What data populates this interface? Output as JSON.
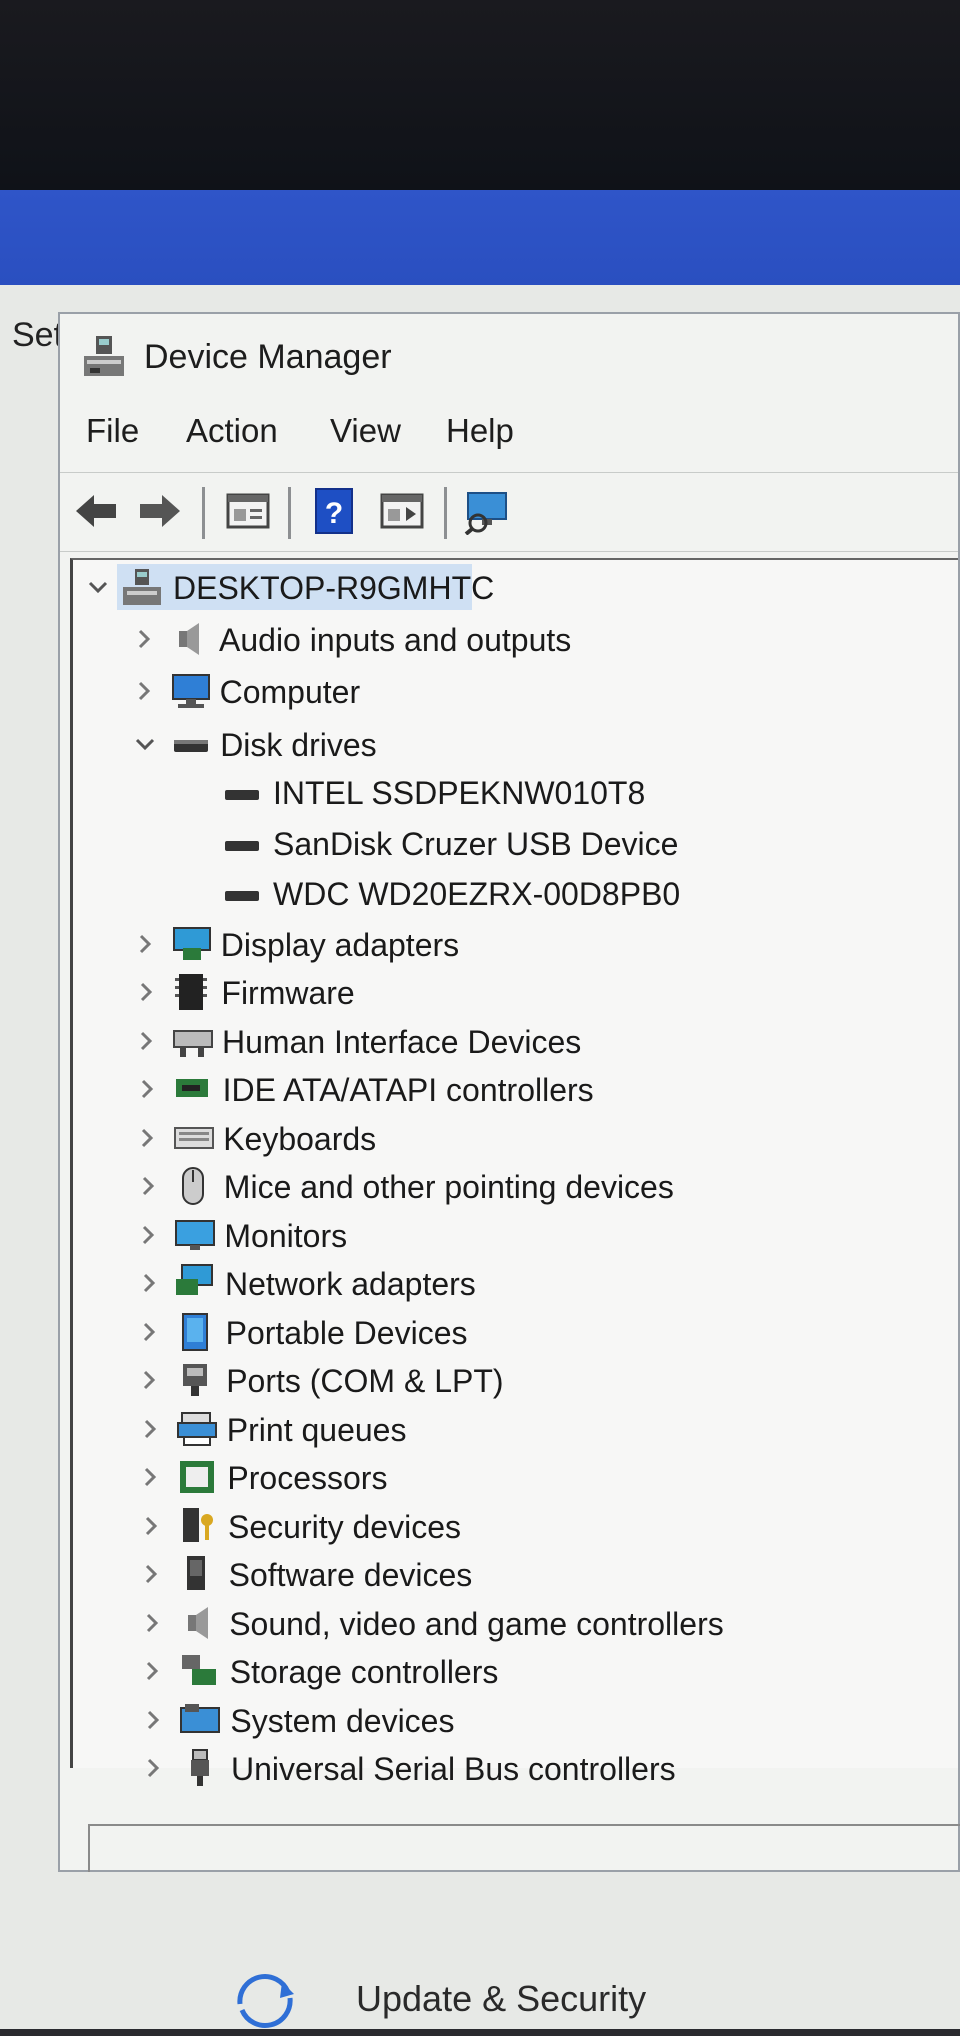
{
  "settings": {
    "partial_title": "Set",
    "bottom_item": "Update & Security"
  },
  "window": {
    "title": "Device Manager",
    "menu": [
      "File",
      "Action",
      "View",
      "Help"
    ]
  },
  "toolbar": {
    "buttons": [
      "back-arrow-icon",
      "forward-arrow-icon",
      "properties-icon",
      "help-icon",
      "update-driver-icon",
      "scan-hardware-icon"
    ]
  },
  "tree": {
    "root": "DESKTOP-R9GMHTC",
    "categories": [
      {
        "label": "Audio inputs and outputs",
        "icon": "speaker-icon"
      },
      {
        "label": "Computer",
        "icon": "computer-icon"
      },
      {
        "label": "Disk drives",
        "icon": "disk-drive-icon",
        "expanded": true
      },
      {
        "label": "Display adapters",
        "icon": "display-adapter-icon"
      },
      {
        "label": "Firmware",
        "icon": "firmware-icon"
      },
      {
        "label": "Human Interface Devices",
        "icon": "hid-icon"
      },
      {
        "label": "IDE ATA/ATAPI controllers",
        "icon": "ide-controller-icon"
      },
      {
        "label": "Keyboards",
        "icon": "keyboard-icon"
      },
      {
        "label": "Mice and other pointing devices",
        "icon": "mouse-icon"
      },
      {
        "label": "Monitors",
        "icon": "monitor-icon"
      },
      {
        "label": "Network adapters",
        "icon": "network-adapter-icon"
      },
      {
        "label": "Portable Devices",
        "icon": "portable-device-icon"
      },
      {
        "label": "Ports (COM & LPT)",
        "icon": "port-icon"
      },
      {
        "label": "Print queues",
        "icon": "printer-icon"
      },
      {
        "label": "Processors",
        "icon": "processor-icon"
      },
      {
        "label": "Security devices",
        "icon": "security-device-icon"
      },
      {
        "label": "Software devices",
        "icon": "software-device-icon"
      },
      {
        "label": "Sound, video and game controllers",
        "icon": "sound-controller-icon"
      },
      {
        "label": "Storage controllers",
        "icon": "storage-controller-icon"
      },
      {
        "label": "System devices",
        "icon": "system-device-icon"
      },
      {
        "label": "Universal Serial Bus controllers",
        "icon": "usb-icon"
      }
    ],
    "disk_drives": [
      "INTEL SSDPEKNW010T8",
      "SanDisk Cruzer USB Device",
      "WDC WD20EZRX-00D8PB0"
    ]
  },
  "colors": {
    "accent_blue": "#2f55c8",
    "selection": "#cfe0f3",
    "window_bg": "#f2f3f1"
  }
}
